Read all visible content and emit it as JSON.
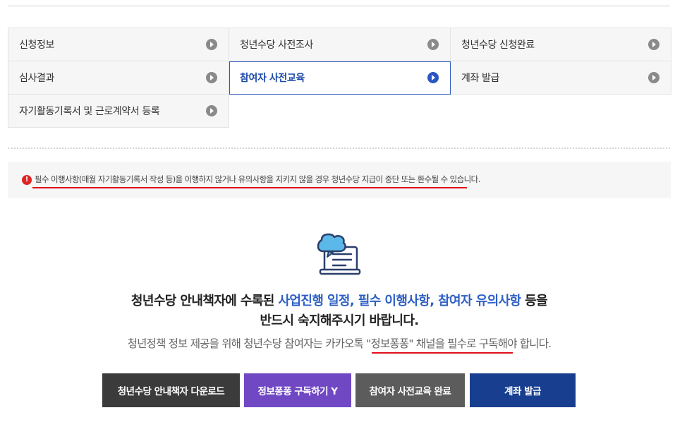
{
  "steps": [
    {
      "label": "신청정보",
      "active": false
    },
    {
      "label": "청년수당 사전조사",
      "active": false
    },
    {
      "label": "청년수당 신청완료",
      "active": false
    },
    {
      "label": "심사결과",
      "active": false
    },
    {
      "label": "참여자 사전교육",
      "active": true
    },
    {
      "label": "계좌 발급",
      "active": false
    },
    {
      "label": "자기활동기록서 및 근로계약서 등록",
      "active": false
    }
  ],
  "notice": {
    "icon": "exclamation-icon",
    "text": "필수 이행사항(매월 자기활동기록서 작성 등)을 이행하지 않거나 유의사항을 지키지 않을 경우 청년수당 지급이 중단 또는 환수될 수 있습니다."
  },
  "guide": {
    "icon": "document-chat-icon",
    "line1_prefix": "청년수당 안내책자에 수록된 ",
    "line1_highlight": "사업진행 일정, 필수 이행사항, 참여자 유의사항",
    "line1_suffix": " 등을",
    "line2": "반드시 숙지해주시기 바랍니다.",
    "subline": "청년정책 정보 제공을 위해 청년수당 참여자는 카카오톡 \"정보퐁퐁\" 채널을 필수로 구독해야 합니다."
  },
  "buttons": {
    "download": "청년수당 안내책자 다운로드",
    "subscribe": "정보퐁퐁 구독하기 Y",
    "complete": "참여자 사전교육 완료",
    "account": "계좌 발급"
  },
  "colors": {
    "accent_blue": "#2d5fc4",
    "active_border": "#2f5bbd",
    "warning_red": "#e02424",
    "btn_download": "#3b3b3b",
    "btn_subscribe": "#7048c4",
    "btn_complete": "#5c5c5c",
    "btn_account": "#173e8f"
  }
}
